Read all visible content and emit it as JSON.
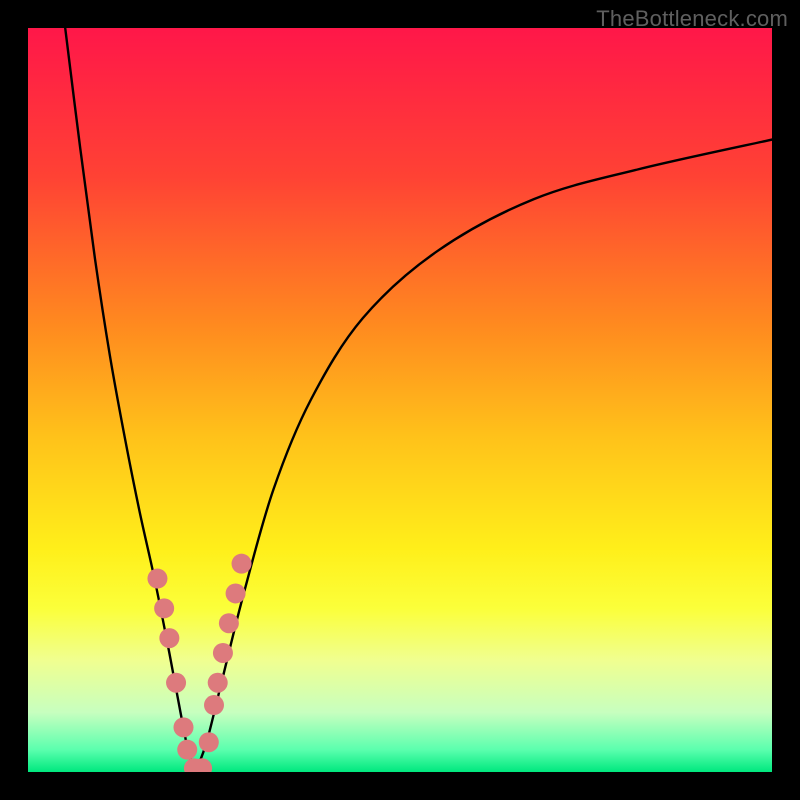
{
  "watermark": "TheBottleneck.com",
  "chart_data": {
    "type": "line",
    "title": "",
    "xlabel": "",
    "ylabel": "",
    "xlim": [
      0,
      100
    ],
    "ylim": [
      0,
      100
    ],
    "grid": false,
    "legend": false,
    "background_gradient": {
      "stops": [
        {
          "pos": 0.0,
          "color": "#ff1749"
        },
        {
          "pos": 0.2,
          "color": "#ff4234"
        },
        {
          "pos": 0.4,
          "color": "#ff8a1f"
        },
        {
          "pos": 0.55,
          "color": "#ffc21a"
        },
        {
          "pos": 0.7,
          "color": "#ffef1a"
        },
        {
          "pos": 0.78,
          "color": "#fbff3a"
        },
        {
          "pos": 0.85,
          "color": "#f0ff90"
        },
        {
          "pos": 0.92,
          "color": "#c7ffbf"
        },
        {
          "pos": 0.97,
          "color": "#5bffae"
        },
        {
          "pos": 1.0,
          "color": "#00e87e"
        }
      ]
    },
    "series": [
      {
        "name": "bottleneck-curve-left",
        "type": "line",
        "x": [
          5,
          7,
          9,
          11,
          13,
          15,
          17,
          19,
          20.5,
          21.5,
          22.5
        ],
        "y": [
          100,
          84,
          69,
          56,
          45,
          35,
          26,
          16,
          8,
          3,
          0
        ]
      },
      {
        "name": "bottleneck-curve-right",
        "type": "line",
        "x": [
          22.5,
          24,
          26,
          29,
          33,
          38,
          45,
          55,
          68,
          82,
          100
        ],
        "y": [
          0,
          4,
          12,
          24,
          38,
          50,
          61,
          70,
          77,
          81,
          85
        ]
      }
    ],
    "scatter": {
      "name": "data-points",
      "color": "#dd7a7d",
      "radius": 10,
      "points": [
        {
          "x": 17.4,
          "y": 26
        },
        {
          "x": 18.3,
          "y": 22
        },
        {
          "x": 19.0,
          "y": 18
        },
        {
          "x": 19.9,
          "y": 12
        },
        {
          "x": 20.9,
          "y": 6
        },
        {
          "x": 21.4,
          "y": 3
        },
        {
          "x": 22.3,
          "y": 0.5
        },
        {
          "x": 23.4,
          "y": 0.5
        },
        {
          "x": 24.3,
          "y": 4
        },
        {
          "x": 25.0,
          "y": 9
        },
        {
          "x": 25.5,
          "y": 12
        },
        {
          "x": 26.2,
          "y": 16
        },
        {
          "x": 27.0,
          "y": 20
        },
        {
          "x": 27.9,
          "y": 24
        },
        {
          "x": 28.7,
          "y": 28
        }
      ]
    }
  }
}
